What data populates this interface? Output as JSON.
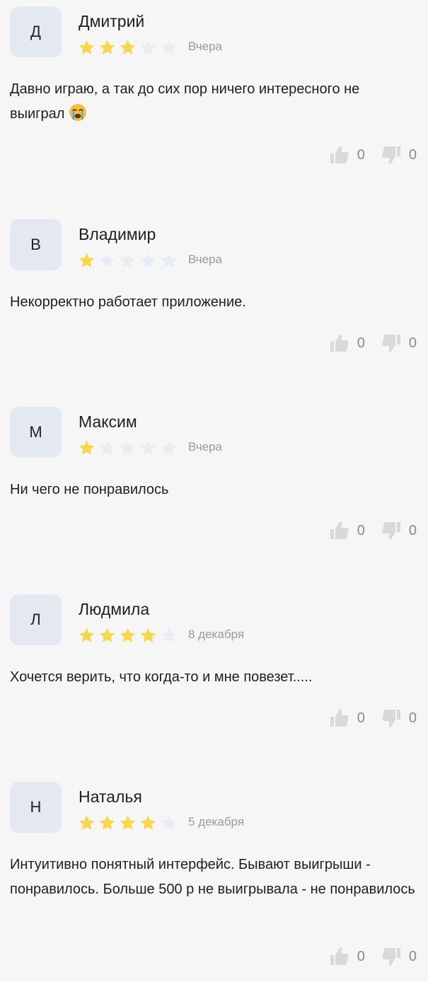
{
  "colors": {
    "star_filled": "#f9d64a",
    "star_empty": "#e8ecf3",
    "avatar_bg": "#e4e8f0",
    "vote_icon": "#d9d9d9"
  },
  "reviews": [
    {
      "initial": "Д",
      "name": "Дмитрий",
      "rating": 3,
      "date": "Вчера",
      "text": "Давно играю, а так до сих пор ничего интересного не выиграл",
      "emoji": "crying-face-icon",
      "likes": "0",
      "dislikes": "0"
    },
    {
      "initial": "В",
      "name": "Владимир",
      "rating": 1,
      "date": "Вчера",
      "text": "Некорректно работает приложение.",
      "likes": "0",
      "dislikes": "0"
    },
    {
      "initial": "М",
      "name": "Максим",
      "rating": 1,
      "date": "Вчера",
      "text": "Ни чего не понравилось",
      "likes": "0",
      "dislikes": "0"
    },
    {
      "initial": "Л",
      "name": "Людмила",
      "rating": 4,
      "date": "8 декабря",
      "text": "Хочется верить, что когда-то и мне повезет.....",
      "likes": "0",
      "dislikes": "0"
    },
    {
      "initial": "Н",
      "name": "Наталья",
      "rating": 4,
      "date": "5 декабря",
      "text": "Интуитивно понятный интерфейс. Бывают выигрыши - понравилось. Больше 500 р не выигрывала - не понравилось",
      "likes": "0",
      "dislikes": "0"
    }
  ]
}
